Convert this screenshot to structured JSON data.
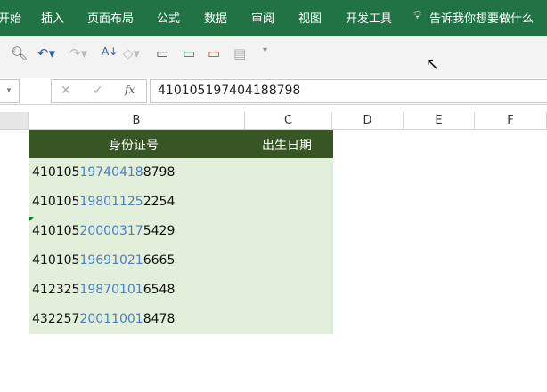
{
  "ribbon": {
    "tabs": [
      "开始",
      "插入",
      "页面布局",
      "公式",
      "数据",
      "审阅",
      "视图",
      "开发工具"
    ],
    "tell_me": "告诉我你想要做什么"
  },
  "formula_bar": {
    "cancel": "✕",
    "enter": "✓",
    "fx": "fx",
    "value": "410105197404188798"
  },
  "columns": [
    "B",
    "C",
    "D",
    "E",
    "F"
  ],
  "table": {
    "headers": [
      "身份证号",
      "出生日期"
    ],
    "rows": [
      {
        "pre": "410105",
        "mid": "19740418",
        "post": "8798"
      },
      {
        "pre": "410105",
        "mid": "19801125",
        "post": "2254"
      },
      {
        "pre": "410105",
        "mid": "20000317",
        "post": "5429"
      },
      {
        "pre": "410105",
        "mid": "19691021",
        "post": "6665"
      },
      {
        "pre": "412325",
        "mid": "19870101",
        "post": "6548"
      },
      {
        "pre": "432257",
        "mid": "20011001",
        "post": "8478"
      }
    ]
  },
  "colors": {
    "ribbon": "#217346",
    "header": "#375623",
    "fill": "#e2efda",
    "highlight": "#4e7fbf"
  }
}
